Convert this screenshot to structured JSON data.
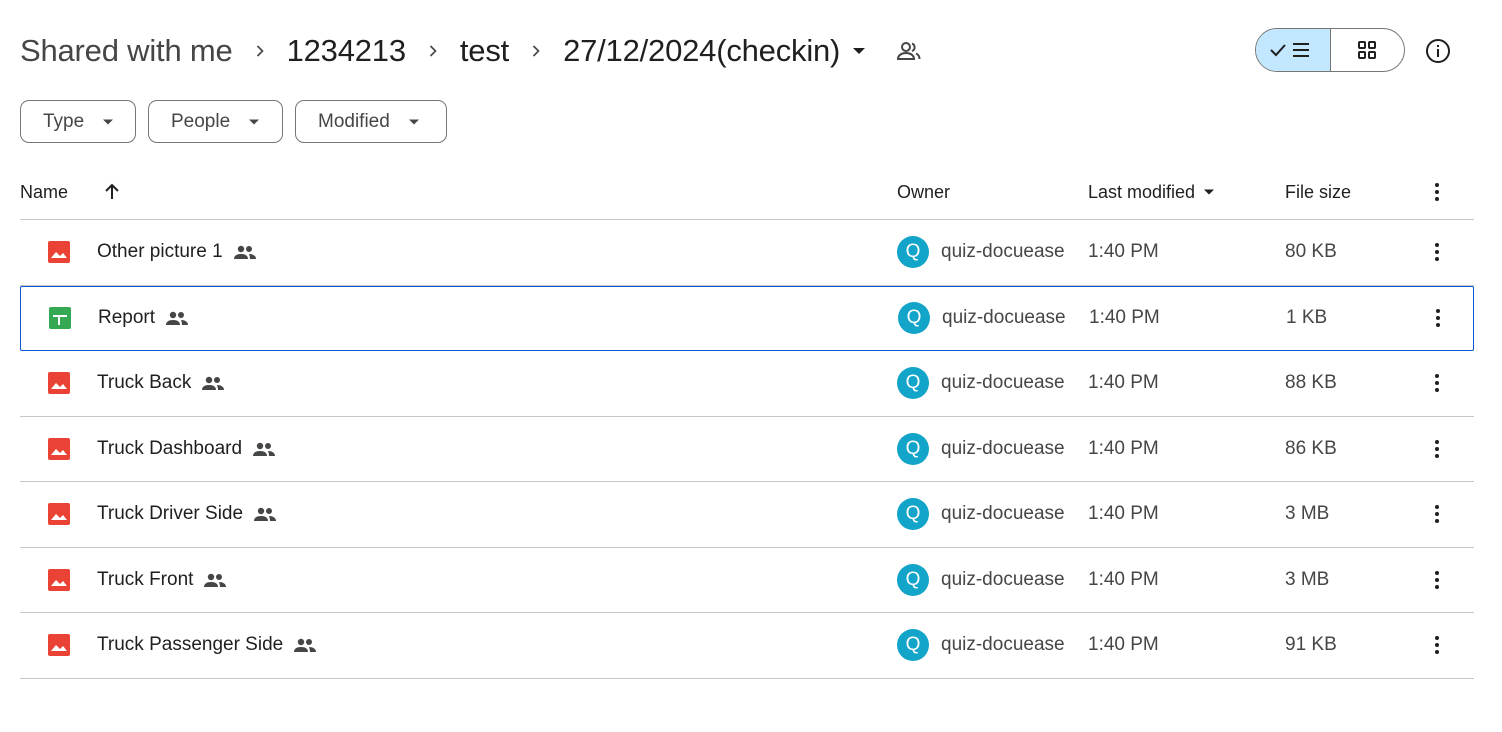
{
  "breadcrumb": {
    "items": [
      "Shared with me",
      "1234213",
      "test"
    ],
    "current": "27/12/2024(checkin)"
  },
  "filters": {
    "type_label": "Type",
    "people_label": "People",
    "modified_label": "Modified"
  },
  "table": {
    "headers": {
      "name": "Name",
      "owner": "Owner",
      "last_modified": "Last modified",
      "file_size": "File size"
    },
    "rows": [
      {
        "name": "Other picture 1",
        "kind": "image",
        "owner_initial": "Q",
        "owner": "quiz-docuease",
        "modified": "1:40 PM",
        "size": "80 KB",
        "selected": false
      },
      {
        "name": "Report",
        "kind": "sheet",
        "owner_initial": "Q",
        "owner": "quiz-docuease",
        "modified": "1:40 PM",
        "size": "1 KB",
        "selected": true
      },
      {
        "name": "Truck Back",
        "kind": "image",
        "owner_initial": "Q",
        "owner": "quiz-docuease",
        "modified": "1:40 PM",
        "size": "88 KB",
        "selected": false
      },
      {
        "name": "Truck Dashboard",
        "kind": "image",
        "owner_initial": "Q",
        "owner": "quiz-docuease",
        "modified": "1:40 PM",
        "size": "86 KB",
        "selected": false
      },
      {
        "name": "Truck Driver Side",
        "kind": "image",
        "owner_initial": "Q",
        "owner": "quiz-docuease",
        "modified": "1:40 PM",
        "size": "3 MB",
        "selected": false
      },
      {
        "name": "Truck Front",
        "kind": "image",
        "owner_initial": "Q",
        "owner": "quiz-docuease",
        "modified": "1:40 PM",
        "size": "3 MB",
        "selected": false
      },
      {
        "name": "Truck Passenger Side",
        "kind": "image",
        "owner_initial": "Q",
        "owner": "quiz-docuease",
        "modified": "1:40 PM",
        "size": "91 KB",
        "selected": false
      }
    ]
  },
  "colors": {
    "image_icon": "#ea4335",
    "sheet_icon": "#34a853",
    "avatar": "#12a4c9",
    "selection_border": "#0b57d0",
    "active_view": "#c2e7ff"
  },
  "icons": {
    "image": "image-file-icon",
    "sheet": "spreadsheet-file-icon",
    "shared": "people-icon",
    "more": "more-vert-icon"
  }
}
